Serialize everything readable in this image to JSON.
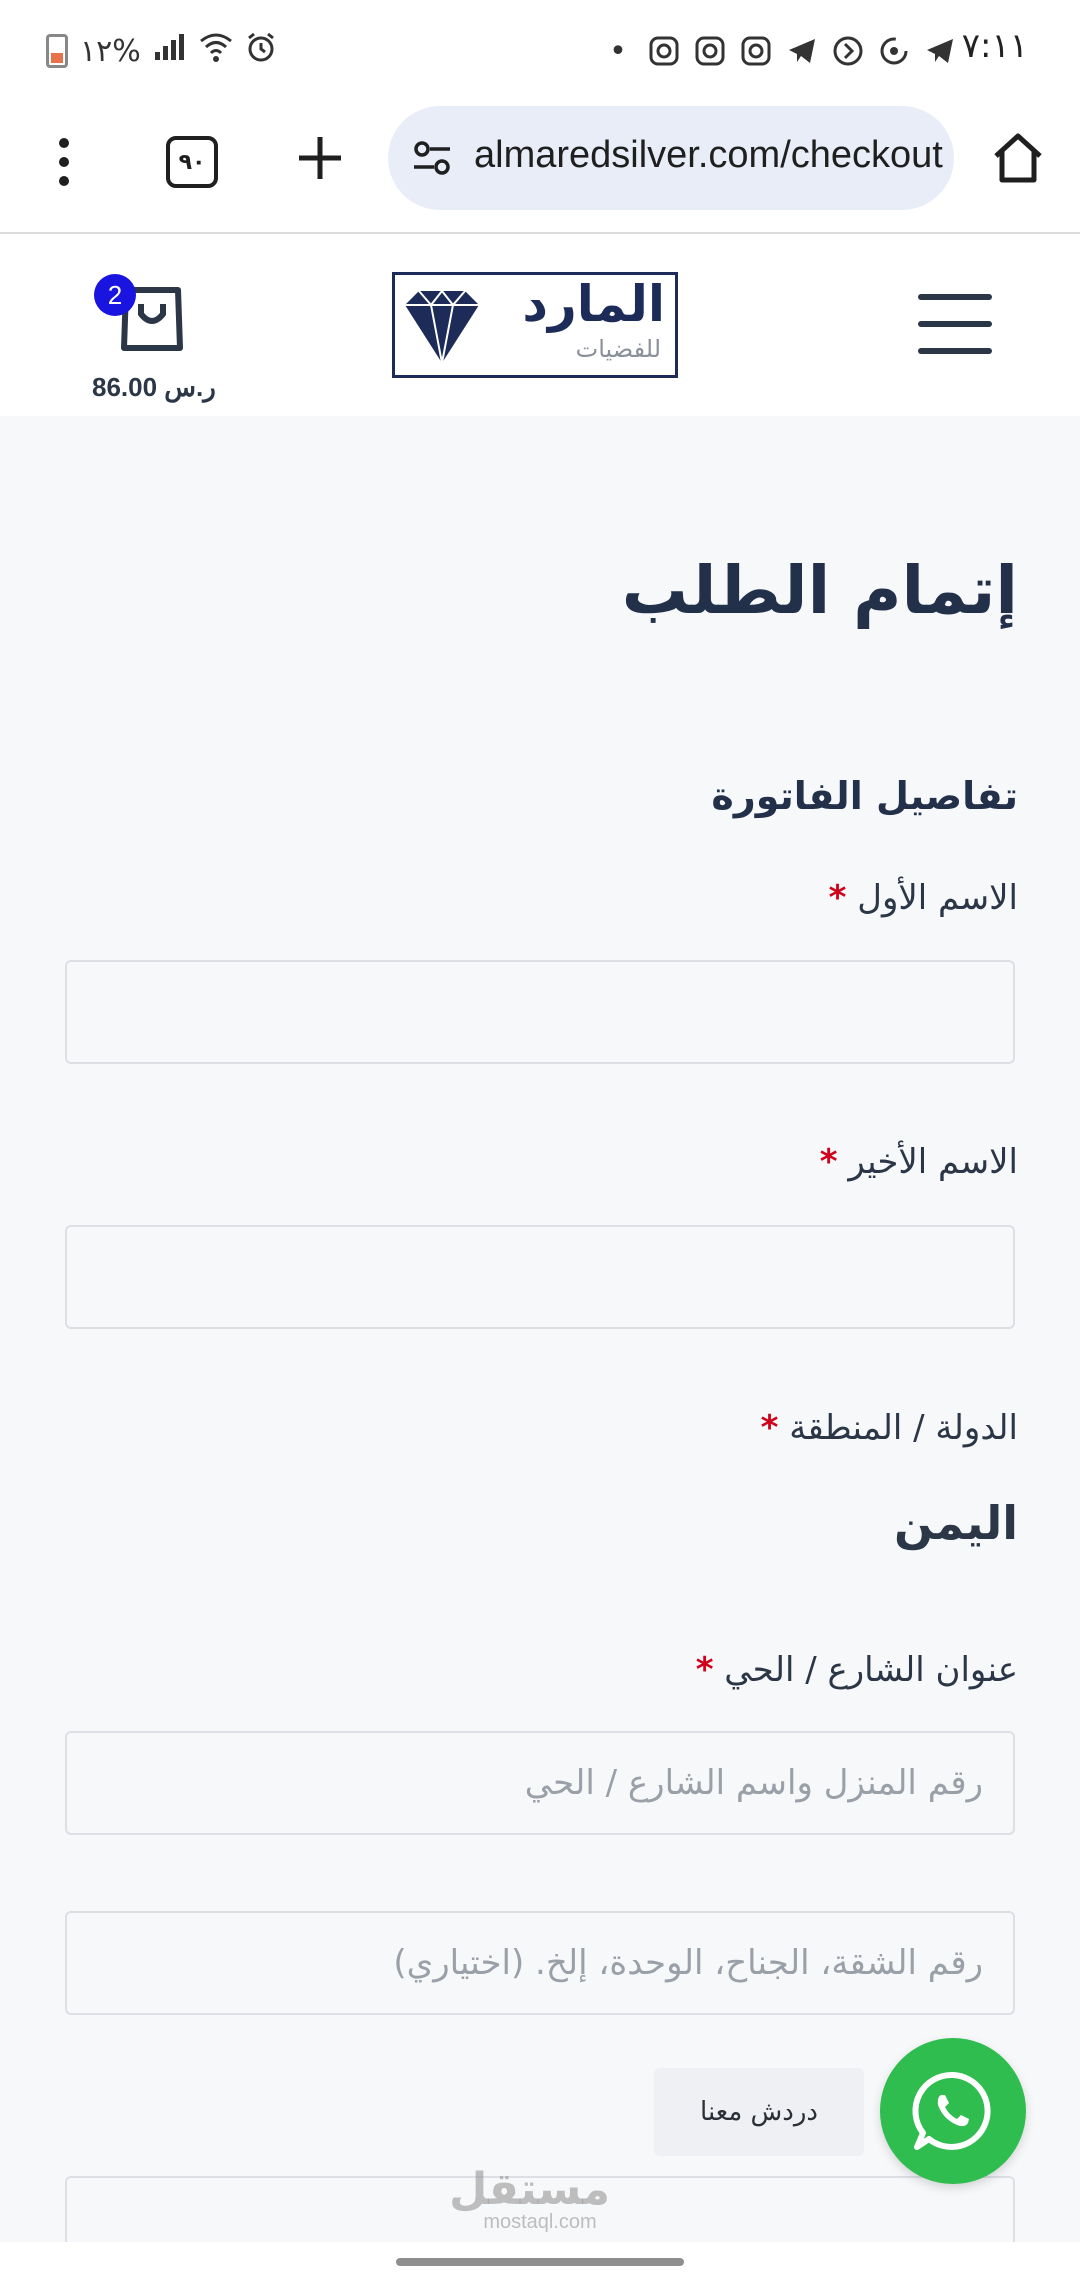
{
  "status_bar": {
    "time": "٧:١١",
    "battery_percent": "١٢%",
    "battery_level": 0.12,
    "icons": [
      "dot-icon",
      "instagram-icon",
      "instagram-icon",
      "instagram-icon",
      "telegram-icon",
      "chevron-circle-icon",
      "sync-icon",
      "telegram-icon",
      "alarm-icon",
      "wifi-icon",
      "signal-icon",
      "battery-icon"
    ]
  },
  "browser": {
    "url": "almaredsilver.com/checkout",
    "tab_count": "٩٠"
  },
  "header": {
    "logo_main": "المارد",
    "logo_sub": "للفضيات",
    "cart_count": "2",
    "cart_total": "86.00 ر.س",
    "colors": {
      "logo_navy": "#1d2b58",
      "badge": "#1a14e0"
    }
  },
  "page": {
    "title": "إتمام الطلب",
    "section_title": "تفاصيل الفاتورة"
  },
  "form": {
    "required_mark": "*",
    "first_name_label": "الاسم الأول",
    "last_name_label": "الاسم الأخير",
    "country_label": "الدولة / المنطقة",
    "country_value": "اليمن",
    "street_label": "عنوان الشارع / الحي",
    "street_placeholder": "رقم المنزل واسم الشارع / الحي",
    "apartment_placeholder": "رقم الشقة، الجناح، الوحدة، إلخ. (اختياري)"
  },
  "chat": {
    "label": "دردش معنا",
    "colors": {
      "whatsapp": "#2ebd4e"
    }
  },
  "watermark": {
    "ar": "مستقل",
    "en": "mostaql.com"
  }
}
